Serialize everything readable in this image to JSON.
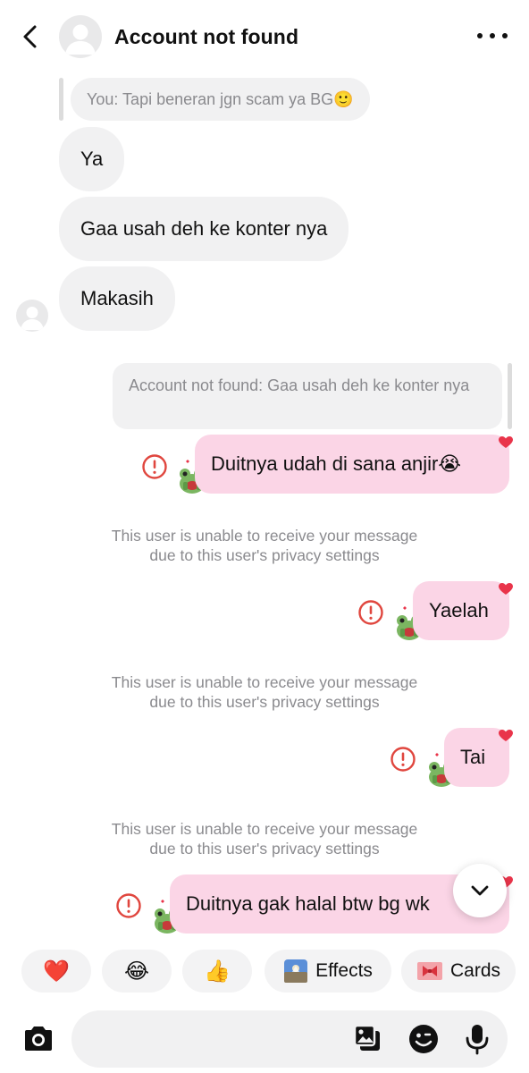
{
  "header": {
    "title": "Account not found",
    "icons": {
      "back": "chevron-left-icon",
      "more": "more-horizontal-icon",
      "avatar": "default-avatar"
    }
  },
  "thread": {
    "quote_in": {
      "text": "You: Tapi beneran jgn scam ya BG🙂"
    },
    "incoming": [
      {
        "text": "Ya"
      },
      {
        "text": "Gaa usah deh ke konter nya"
      },
      {
        "text": "Makasih"
      }
    ],
    "quote_out": {
      "text": "Account not found: Gaa usah deh ke konter nya"
    },
    "outgoing": [
      {
        "text": "Duitnya udah di sana anjir😭",
        "status": "failed"
      },
      {
        "text": "Yaelah",
        "status": "failed"
      },
      {
        "text": "Tai",
        "status": "failed"
      },
      {
        "text": "Duitnya gak halal btw bg wk",
        "status": "failed"
      }
    ],
    "notice": {
      "line1": "This user is unable to receive your message",
      "line2": "due to this user's privacy settings"
    }
  },
  "quick_reactions": [
    {
      "emoji": "❤️",
      "label": ""
    },
    {
      "emoji": "😂",
      "label": ""
    },
    {
      "emoji": "👍",
      "label": ""
    },
    {
      "emoji": "",
      "label": "Effects"
    },
    {
      "emoji": "",
      "label": "Cards"
    }
  ],
  "composer": {
    "placeholder": "",
    "icons": [
      "camera-icon",
      "gallery-icon",
      "sticker-icon",
      "microphone-icon"
    ]
  },
  "colors": {
    "outgoing_bubble": "#fbd5e6",
    "incoming_bubble": "#f1f1f2",
    "error": "#e0463e",
    "heart": "#e9344a",
    "notice_text": "#8a8a8e"
  }
}
